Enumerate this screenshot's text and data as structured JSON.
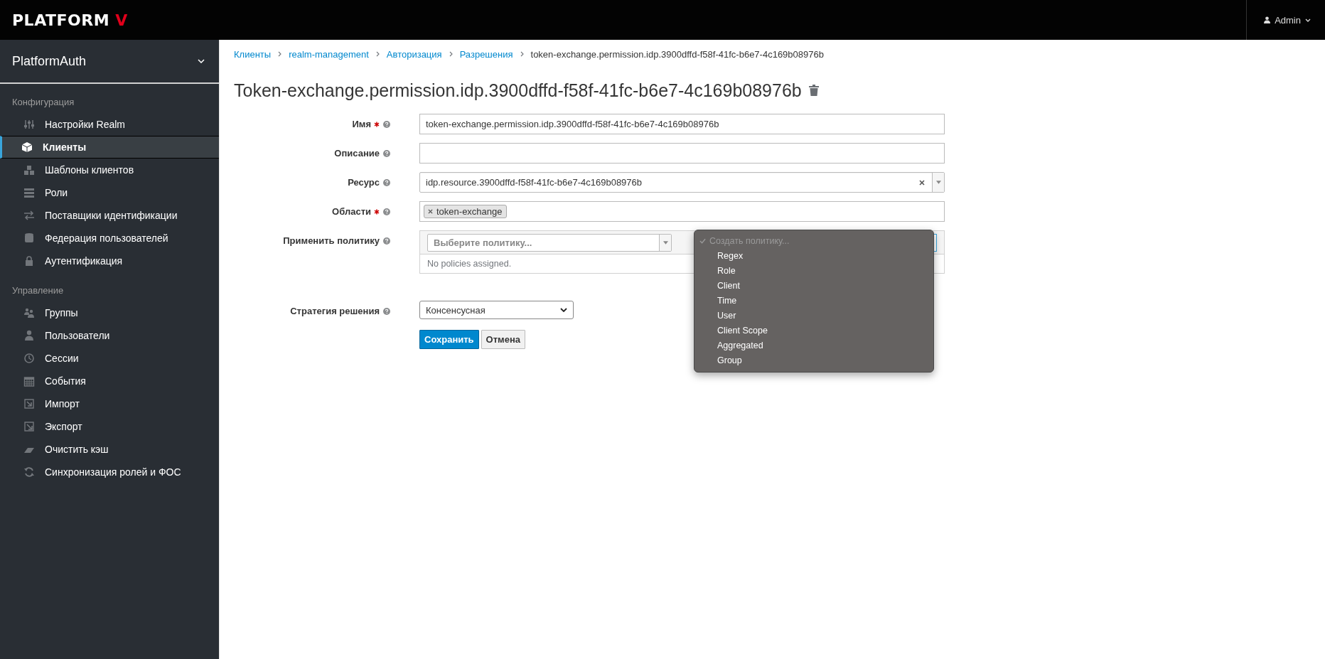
{
  "header": {
    "logo": {
      "text": "PLATFORM",
      "accent": "V"
    },
    "user": "Admin"
  },
  "sidebar": {
    "realm": "PlatformAuth",
    "sections": [
      {
        "title": "Конфигурация",
        "items": [
          {
            "label": "Настройки Realm",
            "selected": false
          },
          {
            "label": "Клиенты",
            "selected": true
          },
          {
            "label": "Шаблоны клиентов",
            "selected": false
          },
          {
            "label": "Роли",
            "selected": false
          },
          {
            "label": "Поставщики идентификации",
            "selected": false
          },
          {
            "label": "Федерация пользователей",
            "selected": false
          },
          {
            "label": "Аутентификация",
            "selected": false
          }
        ]
      },
      {
        "title": "Управление",
        "items": [
          {
            "label": "Группы",
            "selected": false
          },
          {
            "label": "Пользователи",
            "selected": false
          },
          {
            "label": "Сессии",
            "selected": false
          },
          {
            "label": "События",
            "selected": false
          },
          {
            "label": "Импорт",
            "selected": false
          },
          {
            "label": "Экспорт",
            "selected": false
          },
          {
            "label": "Очистить кэш",
            "selected": false
          },
          {
            "label": "Синхронизация ролей и ФОС",
            "selected": false
          }
        ]
      }
    ]
  },
  "breadcrumb": [
    "Клиенты",
    "realm-management",
    "Авторизация",
    "Разрешения",
    "token-exchange.permission.idp.3900dffd-f58f-41fc-b6e7-4c169b08976b"
  ],
  "title": "Token-exchange.permission.idp.3900dffd-f58f-41fc-b6e7-4c169b08976b",
  "form": [
    {
      "kind": "text",
      "label": "Имя",
      "required": true,
      "value": "token-exchange.permission.idp.3900dffd-f58f-41fc-b6e7-4c169b08976b"
    },
    {
      "kind": "text",
      "label": "Описание",
      "required": false
    },
    {
      "kind": "combo",
      "label": "Ресурс",
      "required": false,
      "value": "idp.resource.3900dffd-f58f-41fc-b6e7-4c169b08976b"
    },
    {
      "kind": "tags",
      "label": "Области",
      "required": true,
      "tags": [
        "token-exchange"
      ]
    },
    {
      "kind": "policy",
      "label": "Применить политику",
      "required": false,
      "placeholder": "Выберите политику...",
      "empty": "No policies assigned.",
      "menu": [
        {
          "label": "Создать политику...",
          "selected": true
        },
        {
          "label": "Regex",
          "selected": false
        },
        {
          "label": "Role",
          "selected": false
        },
        {
          "label": "Client",
          "selected": false
        },
        {
          "label": "Time",
          "selected": false
        },
        {
          "label": "User",
          "selected": false
        },
        {
          "label": "Client Scope",
          "selected": false
        },
        {
          "label": "Aggregated",
          "selected": false
        },
        {
          "label": "Group",
          "selected": false
        }
      ]
    },
    {
      "kind": "select",
      "label": "Стратегия решения",
      "required": false,
      "value": "Консенсусная"
    }
  ],
  "buttons": [
    {
      "label": "Сохранить",
      "primary": true
    },
    {
      "label": "Отмена",
      "primary": false
    }
  ]
}
